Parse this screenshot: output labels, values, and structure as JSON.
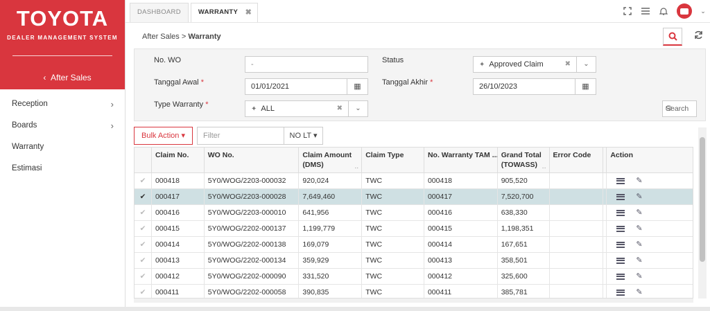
{
  "brand": {
    "logo": "TOYOTA",
    "tagline": "DEALER MANAGEMENT SYSTEM"
  },
  "sidebar": {
    "back_label": "After Sales",
    "items": [
      {
        "label": "Reception",
        "has_children": true
      },
      {
        "label": "Boards",
        "has_children": true
      },
      {
        "label": "Warranty",
        "has_children": false
      },
      {
        "label": "Estimasi",
        "has_children": false
      }
    ]
  },
  "tabs": [
    {
      "label": "DASHBOARD"
    },
    {
      "label": "WARRANTY",
      "close": "✖"
    }
  ],
  "breadcrumb": {
    "parent": "After Sales",
    "separator": ">",
    "current": "Warranty"
  },
  "filters": {
    "no_wo": {
      "label": "No. WO",
      "value": "-"
    },
    "status": {
      "label": "Status",
      "value": "Approved Claim"
    },
    "tanggal_awal": {
      "label": "Tanggal Awal",
      "required": "*",
      "value": "01/01/2021"
    },
    "tanggal_akhir": {
      "label": "Tanggal Akhir",
      "required": "*",
      "value": "26/10/2023"
    },
    "type_warranty": {
      "label": "Type Warranty",
      "required": "*",
      "value": "ALL"
    },
    "search_button": "Search"
  },
  "toolbar": {
    "bulk_action": "Bulk Action ▾",
    "filter_placeholder": "Filter",
    "nolt": "NO LT ▾"
  },
  "table": {
    "headers": [
      "Claim No.",
      "WO No.",
      "Claim Amount (DMS)",
      "Claim Type",
      "No. Warranty TAM ...",
      "Grand Total (TOWASS)",
      "Error Code",
      "Action"
    ],
    "rows": [
      {
        "check": "✔",
        "claim_no": "000418",
        "wo_no": "5Y0/WOG/2203-000032",
        "amount": "920,024",
        "type": "TWC",
        "tam": "000418",
        "total": "905,520",
        "selected": false
      },
      {
        "check": "✔",
        "claim_no": "000417",
        "wo_no": "5Y0/WOG/2203-000028",
        "amount": "7,649,460",
        "type": "TWC",
        "tam": "000417",
        "total": "7,520,700",
        "selected": true
      },
      {
        "check": "✔",
        "claim_no": "000416",
        "wo_no": "5Y0/WOG/2203-000010",
        "amount": "641,956",
        "type": "TWC",
        "tam": "000416",
        "total": "638,330",
        "selected": false
      },
      {
        "check": "✔",
        "claim_no": "000415",
        "wo_no": "5Y0/WOG/2202-000137",
        "amount": "1,199,779",
        "type": "TWC",
        "tam": "000415",
        "total": "1,198,351",
        "selected": false
      },
      {
        "check": "✔",
        "claim_no": "000414",
        "wo_no": "5Y0/WOG/2202-000138",
        "amount": "169,079",
        "type": "TWC",
        "tam": "000414",
        "total": "167,651",
        "selected": false
      },
      {
        "check": "✔",
        "claim_no": "000413",
        "wo_no": "5Y0/WOG/2202-000134",
        "amount": "359,929",
        "type": "TWC",
        "tam": "000413",
        "total": "358,501",
        "selected": false
      },
      {
        "check": "✔",
        "claim_no": "000412",
        "wo_no": "5Y0/WOG/2202-000090",
        "amount": "331,520",
        "type": "TWC",
        "tam": "000412",
        "total": "325,600",
        "selected": false
      },
      {
        "check": "✔",
        "claim_no": "000411",
        "wo_no": "5Y0/WOG/2202-000058",
        "amount": "390,835",
        "type": "TWC",
        "tam": "000411",
        "total": "385,781",
        "selected": false
      }
    ]
  },
  "colors": {
    "accent": "#d9363e",
    "selected_row": "#cfe0e3"
  }
}
